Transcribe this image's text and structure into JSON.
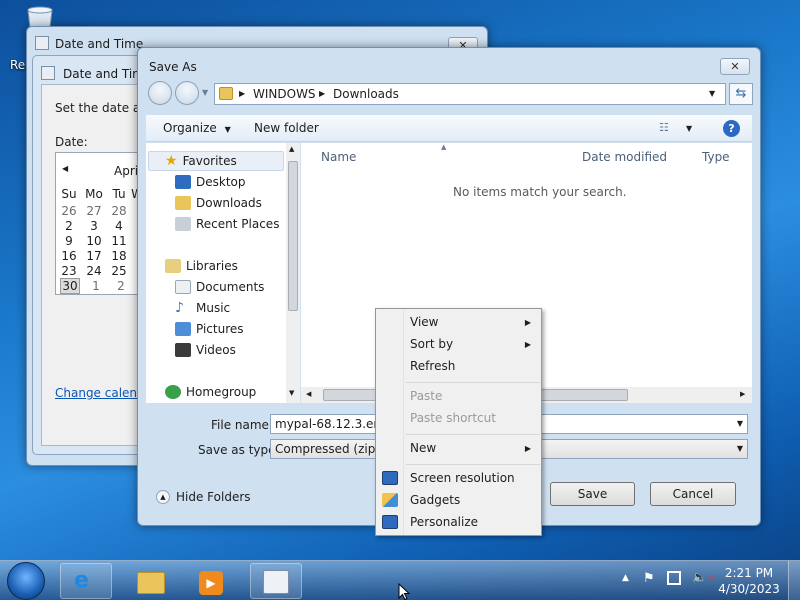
{
  "desktop": {
    "recycle_bin_label": "Rec"
  },
  "date_time_back": {
    "title": "Date and Time"
  },
  "date_time_front": {
    "title": "Date and Tim",
    "instruction": "Set the date anc",
    "date_label": "Date:",
    "month_label": "Apri",
    "prev_arrow": "◀",
    "weekdays": [
      "Su",
      "Mo",
      "Tu",
      "W"
    ],
    "weeks": [
      [
        "26",
        "27",
        "28"
      ],
      [
        "2",
        "3",
        "4"
      ],
      [
        "9",
        "10",
        "11"
      ],
      [
        "16",
        "17",
        "18"
      ],
      [
        "23",
        "24",
        "25"
      ],
      [
        "30",
        "1",
        "2"
      ]
    ],
    "change_calendar_link": "Change calenda"
  },
  "save_as": {
    "title": "Save As",
    "close_glyph": "✕",
    "breadcrumb": [
      "WINDOWS",
      "Downloads"
    ],
    "toolbar": {
      "organize": "Organize",
      "new_folder": "New folder"
    },
    "nav": {
      "favorites": "Favorites",
      "desktop": "Desktop",
      "downloads": "Downloads",
      "recent_places": "Recent Places",
      "libraries": "Libraries",
      "documents": "Documents",
      "music": "Music",
      "pictures": "Pictures",
      "videos": "Videos",
      "homegroup": "Homegroup"
    },
    "columns": {
      "name": "Name",
      "date_modified": "Date modified",
      "type": "Type"
    },
    "empty_message": "No items match your search.",
    "file_name_label": "File name:",
    "file_name_value": "mypal-68.12.3.en-U",
    "save_type_label": "Save as type:",
    "save_type_value": "Compressed (zippe",
    "hide_folders": "Hide Folders",
    "save_button": "Save",
    "cancel_button": "Cancel"
  },
  "context_menu": {
    "view": "View",
    "sort_by": "Sort by",
    "refresh": "Refresh",
    "paste": "Paste",
    "paste_shortcut": "Paste shortcut",
    "new": "New",
    "screen_resolution": "Screen resolution",
    "gadgets": "Gadgets",
    "personalize": "Personalize"
  },
  "taskbar": {
    "time": "2:21 PM",
    "date": "4/30/2023"
  }
}
